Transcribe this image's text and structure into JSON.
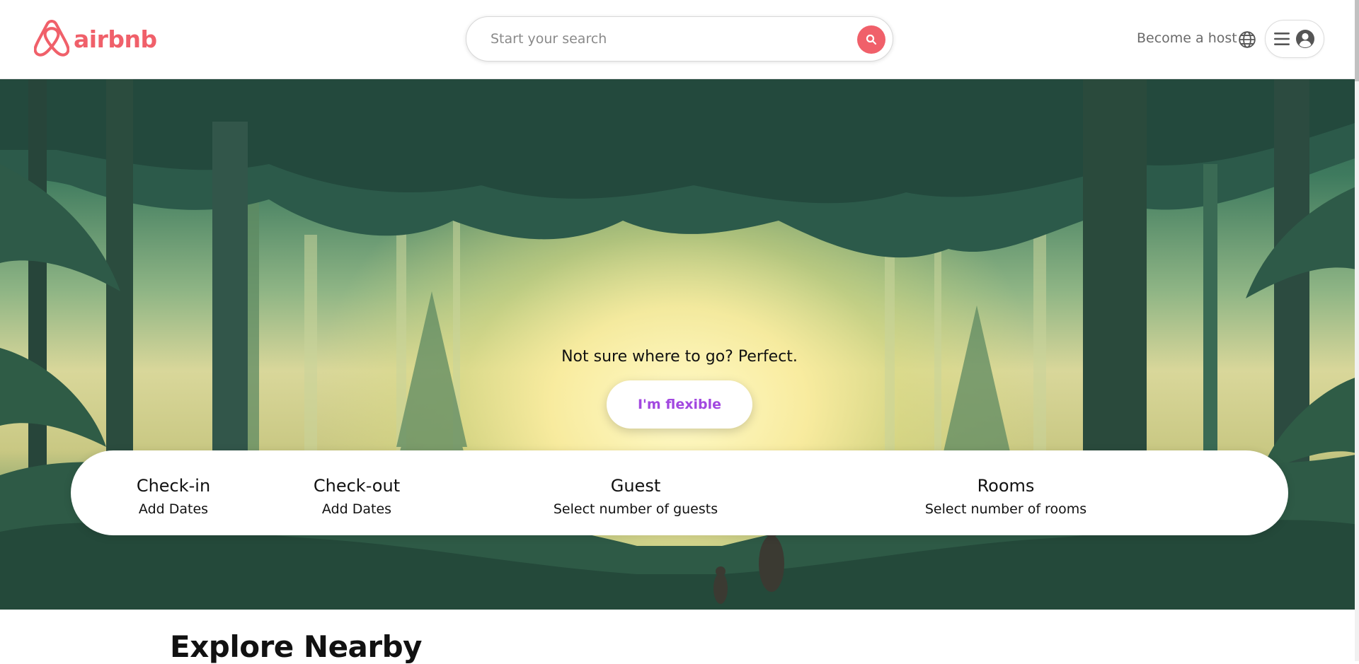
{
  "brand": {
    "name": "airbnb",
    "color": "#f0606a",
    "icon": "airbnb-logo-icon"
  },
  "search": {
    "placeholder": "Start your search",
    "button_icon": "search-icon"
  },
  "nav": {
    "become_host": "Become a host",
    "globe_icon": "globe-icon",
    "menu_icon": "hamburger-menu-icon",
    "user_icon": "user-avatar-icon"
  },
  "hero": {
    "tagline": "Not sure where to go? Perfect.",
    "cta": "I'm flexible",
    "cta_color": "#a248e0"
  },
  "booking": {
    "checkin": {
      "label": "Check-in",
      "value": "Add Dates"
    },
    "checkout": {
      "label": "Check-out",
      "value": "Add Dates"
    },
    "guest": {
      "label": "Guest",
      "value": "Select number of guests"
    },
    "rooms": {
      "label": "Rooms",
      "value": "Select number of rooms"
    }
  },
  "explore": {
    "title": "Explore Nearby"
  }
}
